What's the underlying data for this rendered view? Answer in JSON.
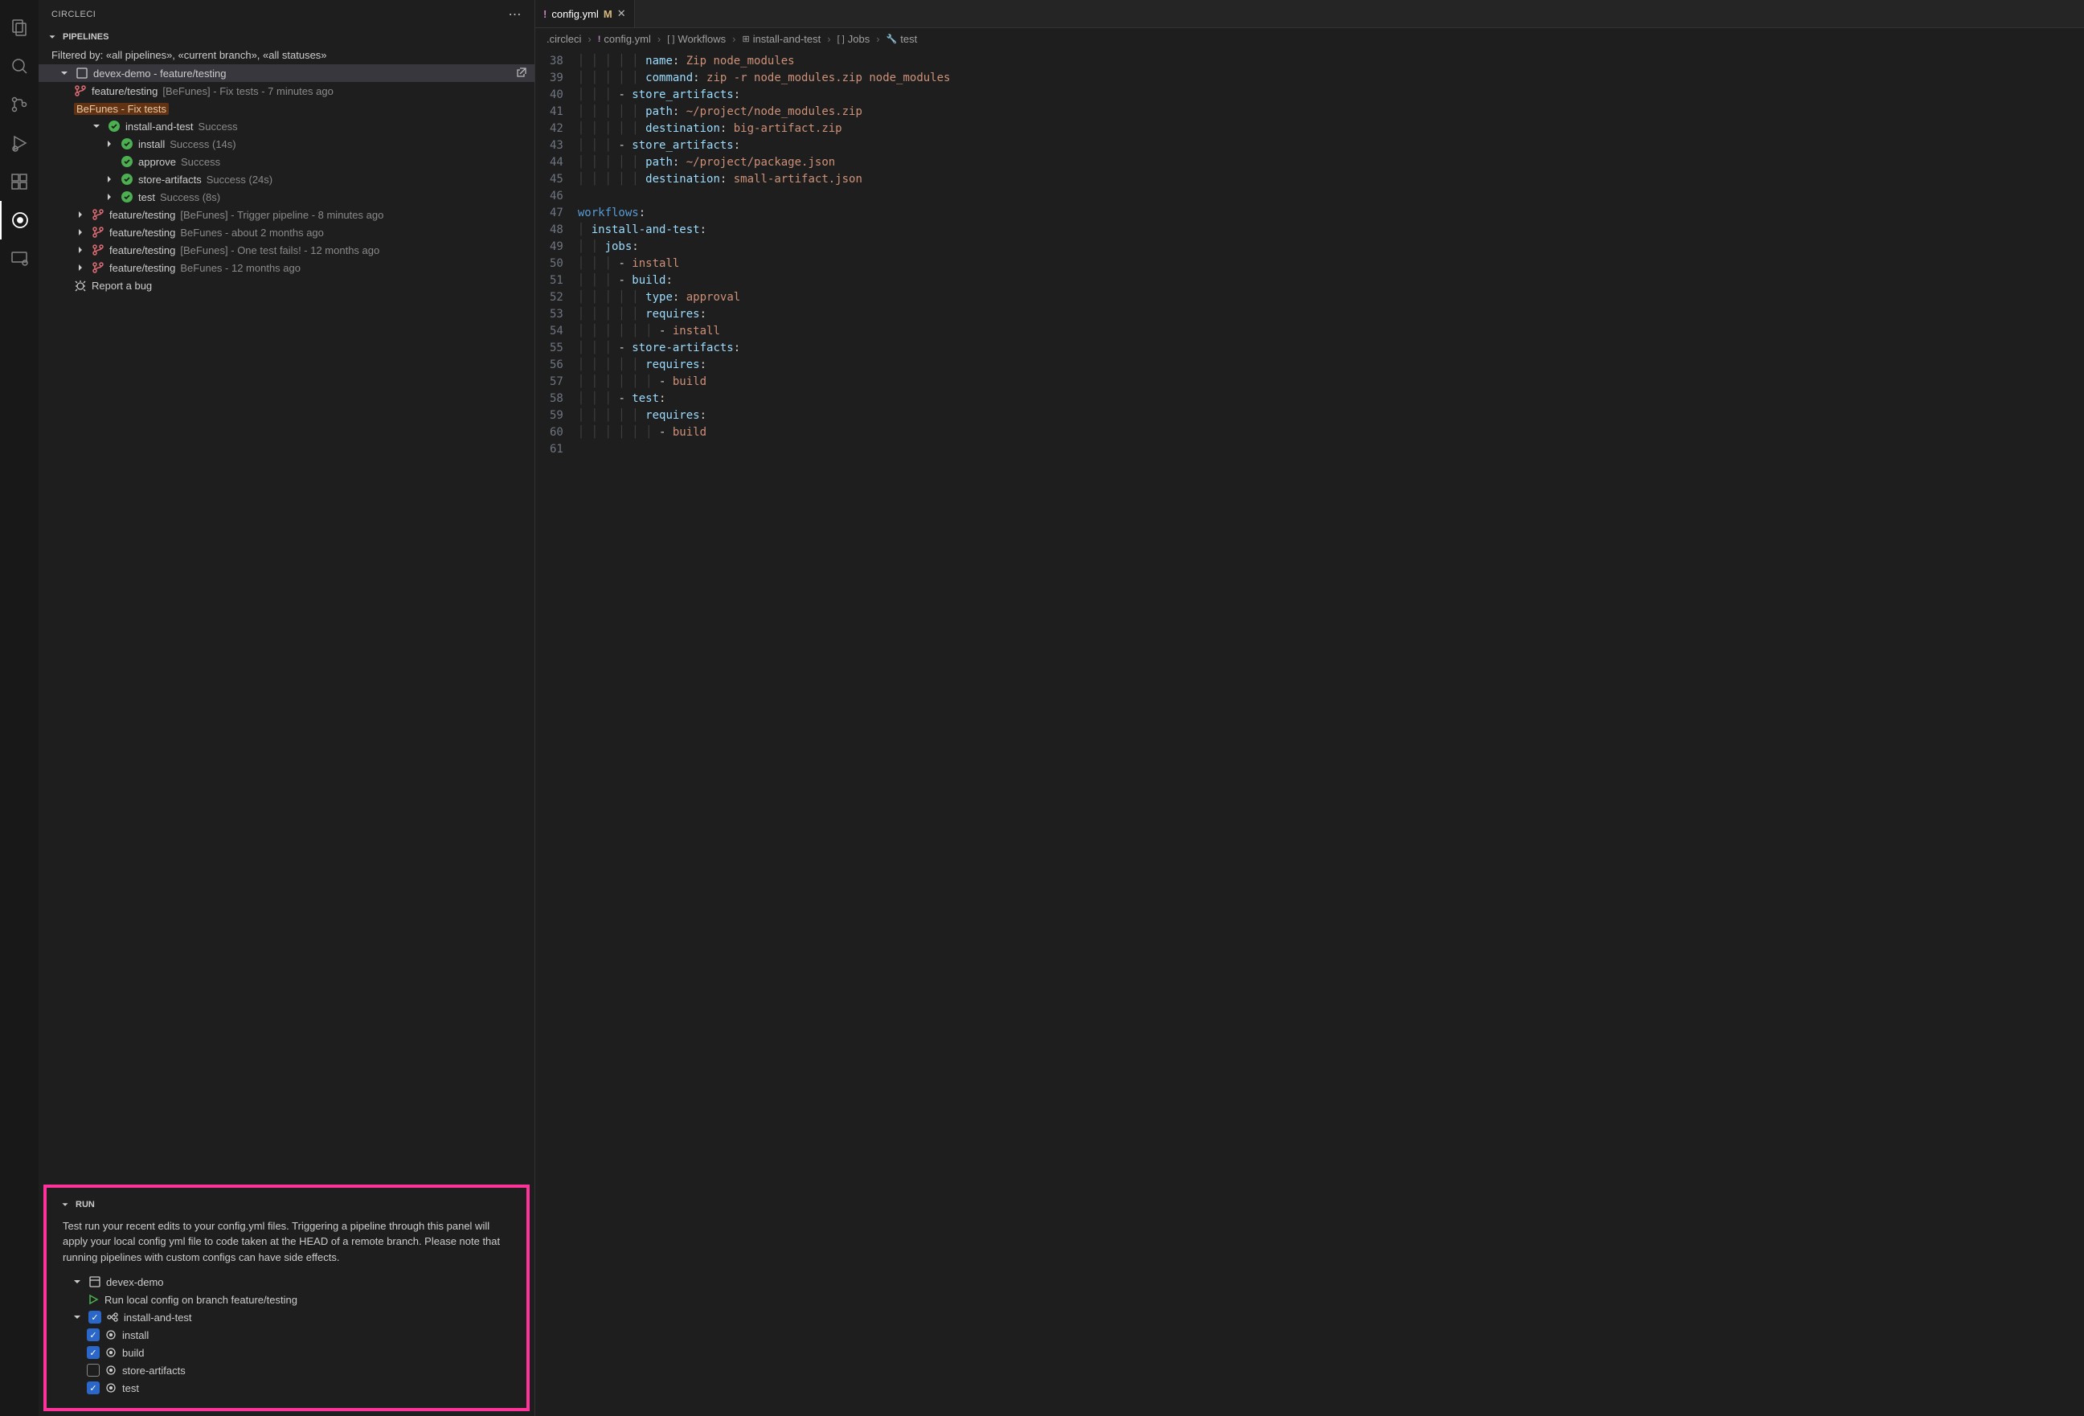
{
  "sidebar_title": "CIRCLECI",
  "pipelines_header": "PIPELINES",
  "filter_text": "Filtered by: «all pipelines», «current branch», «all statuses»",
  "project_row": "devex-demo - feature/testing",
  "pipeline_rows": [
    {
      "branch": "feature/testing",
      "meta": "[BeFunes] - Fix tests - 7 minutes ago"
    }
  ],
  "highlight": "BeFunes - Fix tests",
  "workflow": {
    "name": "install-and-test",
    "status": "Success"
  },
  "jobs": [
    {
      "name": "install",
      "status": "Success (14s)"
    },
    {
      "name": "approve",
      "status": "Success"
    },
    {
      "name": "store-artifacts",
      "status": "Success (24s)"
    },
    {
      "name": "test",
      "status": "Success (8s)"
    }
  ],
  "other_pipelines": [
    {
      "branch": "feature/testing",
      "meta": "[BeFunes] - Trigger pipeline - 8 minutes ago"
    },
    {
      "branch": "feature/testing",
      "meta": "BeFunes - about 2 months ago"
    },
    {
      "branch": "feature/testing",
      "meta": "[BeFunes] - One test fails! - 12 months ago"
    },
    {
      "branch": "feature/testing",
      "meta": "BeFunes - 12 months ago"
    }
  ],
  "report_bug": "Report a bug",
  "run": {
    "header": "RUN",
    "desc": "Test run your recent edits to your config.yml files. Triggering a pipeline through this panel will apply your local config yml file to code taken at the HEAD of a remote branch. Please note that running pipelines with custom configs can have side effects.",
    "project": "devex-demo",
    "run_label": "Run local config on branch feature/testing",
    "workflow": "install-and-test",
    "items": [
      {
        "name": "install",
        "checked": true
      },
      {
        "name": "build",
        "checked": true
      },
      {
        "name": "store-artifacts",
        "checked": false
      },
      {
        "name": "test",
        "checked": true
      }
    ]
  },
  "tab": {
    "name": "config.yml",
    "modified": "M"
  },
  "breadcrumbs": [
    ".circleci",
    "config.yml",
    "Workflows",
    "install-and-test",
    "Jobs",
    "test"
  ],
  "code": {
    "first_line": 38,
    "lines": [
      {
        "indent": 5,
        "key": "name",
        "val": "Zip node_modules"
      },
      {
        "indent": 5,
        "key": "command",
        "val": "zip -r node_modules.zip node_modules"
      },
      {
        "indent": 3,
        "dash": true,
        "key": "store_artifacts",
        "noval": true
      },
      {
        "indent": 5,
        "key": "path",
        "val": "~/project/node_modules.zip"
      },
      {
        "indent": 5,
        "key": "destination",
        "val": "big-artifact.zip"
      },
      {
        "indent": 3,
        "dash": true,
        "key": "store_artifacts",
        "noval": true
      },
      {
        "indent": 5,
        "key": "path",
        "val": "~/project/package.json"
      },
      {
        "indent": 5,
        "key": "destination",
        "val": "small-artifact.json"
      },
      {
        "blank": true
      },
      {
        "indent": 0,
        "key": "workflows",
        "section": true,
        "noval": true
      },
      {
        "indent": 1,
        "key": "install-and-test",
        "noval": true
      },
      {
        "indent": 2,
        "key": "jobs",
        "noval": true
      },
      {
        "indent": 3,
        "dash": true,
        "scalar": "install"
      },
      {
        "indent": 3,
        "dash": true,
        "key": "build",
        "noval": true
      },
      {
        "indent": 5,
        "key": "type",
        "val": "approval"
      },
      {
        "indent": 5,
        "key": "requires",
        "noval": true
      },
      {
        "indent": 6,
        "dash": true,
        "scalar": "install"
      },
      {
        "indent": 3,
        "dash": true,
        "key": "store-artifacts",
        "noval": true
      },
      {
        "indent": 5,
        "key": "requires",
        "noval": true
      },
      {
        "indent": 6,
        "dash": true,
        "scalar": "build"
      },
      {
        "indent": 3,
        "dash": true,
        "key": "test",
        "noval": true
      },
      {
        "indent": 5,
        "key": "requires",
        "noval": true
      },
      {
        "indent": 6,
        "dash": true,
        "scalar": "build"
      },
      {
        "blank": true
      }
    ]
  }
}
